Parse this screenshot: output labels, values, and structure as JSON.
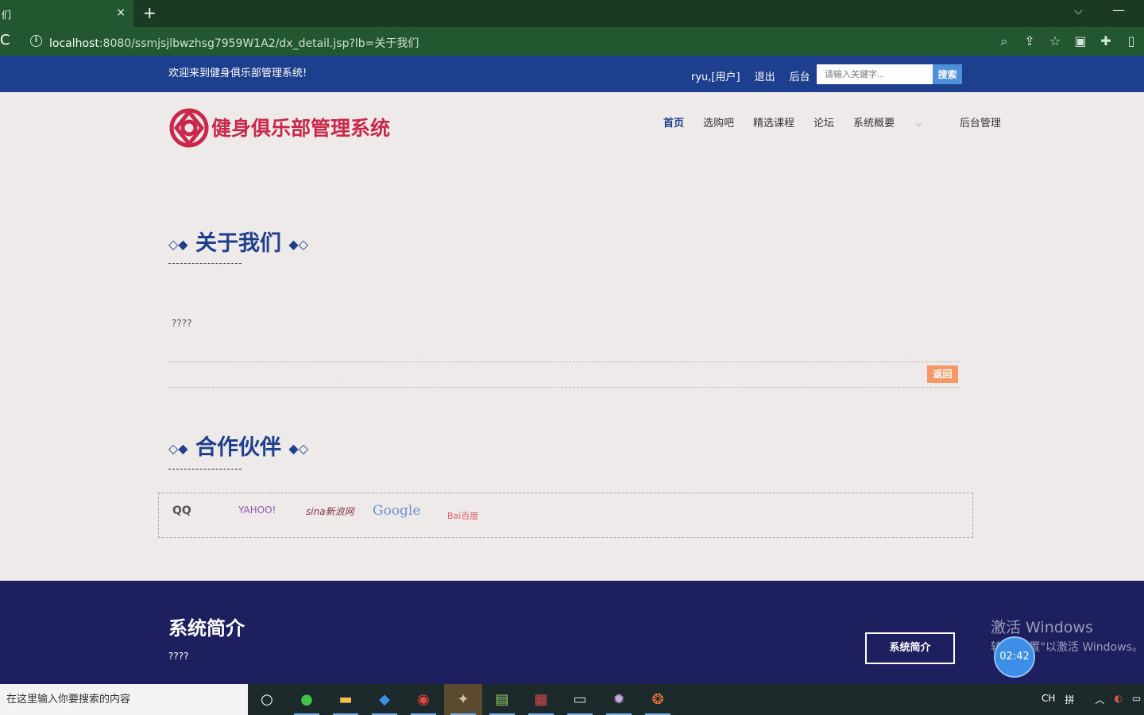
{
  "browser": {
    "tab_title": "们",
    "tab_close": "×",
    "new_tab": "+",
    "tab_list": "⌵",
    "window_minimize": "—",
    "reload": "C",
    "url_host": "localhost",
    "url_path": ":8080/ssmjsjlbwzhsg7959W1A2/dx_detail.jsp?lb=关于我们"
  },
  "topbar": {
    "welcome": "欢迎来到健身俱乐部管理系统!",
    "user": "ryu,[用户]",
    "logout": "退出",
    "admin": "后台",
    "search_placeholder": "请输入关键字...",
    "search_button": "搜索"
  },
  "header": {
    "brand": "健身俱乐部管理系统",
    "nav": [
      "首页",
      "选购吧",
      "精选课程",
      "论坛",
      "系统概要",
      "后台管理"
    ]
  },
  "about": {
    "title": "关于我们",
    "content": "????",
    "back_button": "返回"
  },
  "partners": {
    "title": "合作伙伴",
    "logos": [
      "QQ",
      "YAHOO!",
      "sina新浪网",
      "Google",
      "Bai百度"
    ]
  },
  "footer": {
    "title": "系统简介",
    "text": "????",
    "button": "系统简介",
    "activate_line1": "激活 Windows",
    "activate_line2": "转到\"设置\"以激活 Windows。",
    "timer": "02:42"
  },
  "taskbar": {
    "search_placeholder": "在这里输入你要搜索的内容",
    "ime": "CH",
    "ime_mode": "拼"
  },
  "colors": {
    "primary": "#1e3f8d",
    "brand": "#c8284a",
    "footer": "#1e1f5e",
    "accent": "#f59866",
    "page_bg": "#efeaea"
  }
}
